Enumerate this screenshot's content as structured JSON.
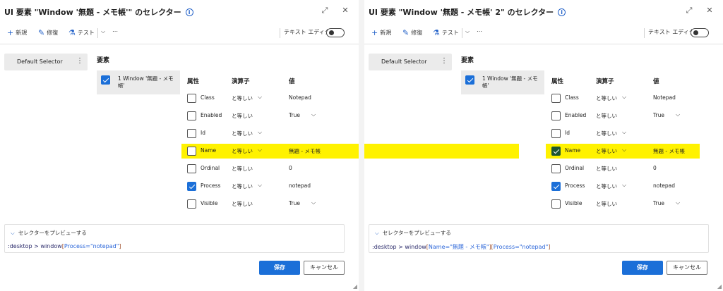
{
  "left": {
    "title": "UI 要素 \"Window '無題 - メモ帳'\" のセレクター",
    "toolbar": {
      "new_label": "新規",
      "edit_label": "修復",
      "test_label": "テスト",
      "text_editor_label": "テキスト エディター"
    },
    "selector_label": "Default Selector",
    "section_title": "要素",
    "element_label": "1 Window '無題 - メモ帳'",
    "headers": {
      "attribute": "属性",
      "operator": "演算子",
      "value": "値"
    },
    "rows": [
      {
        "name": "Class",
        "op": "と等しい",
        "value": "Notepad",
        "checked": false,
        "op_chevron": true,
        "val_chevron": false
      },
      {
        "name": "Enabled",
        "op": "と等しい",
        "value": "True",
        "checked": false,
        "op_chevron": false,
        "val_chevron": true
      },
      {
        "name": "Id",
        "op": "と等しい",
        "value": "",
        "checked": false,
        "op_chevron": true,
        "val_chevron": false
      },
      {
        "name": "Name",
        "op": "と等しい",
        "value": "無題 - メモ帳",
        "checked": false,
        "op_chevron": true,
        "val_chevron": false
      },
      {
        "name": "Ordinal",
        "op": "と等しい",
        "value": "0",
        "checked": false,
        "op_chevron": false,
        "val_chevron": false
      },
      {
        "name": "Process",
        "op": "と等しい",
        "value": "notepad",
        "checked": true,
        "op_chevron": true,
        "val_chevron": false
      },
      {
        "name": "Visible",
        "op": "と等しい",
        "value": "True",
        "checked": false,
        "op_chevron": false,
        "val_chevron": true
      }
    ],
    "preview_label": "セレクターをプレビューする",
    "expr": {
      "root": ":desktop",
      "gt": " > ",
      "tag": "window",
      "attrs": "Process=\"notepad\""
    },
    "save_label": "保存",
    "cancel_label": "キャンセル"
  },
  "right": {
    "title": "UI 要素 \"Window '無題 - メモ帳' 2\" のセレクター",
    "toolbar": {
      "new_label": "新規",
      "edit_label": "修復",
      "test_label": "テスト",
      "text_editor_label": "テキスト エディター"
    },
    "selector_label": "Default Selector",
    "section_title": "要素",
    "element_label": "1 Window '無題 - メモ帳'",
    "headers": {
      "attribute": "属性",
      "operator": "演算子",
      "value": "値"
    },
    "rows": [
      {
        "name": "Class",
        "op": "と等しい",
        "value": "Notepad",
        "checked": false,
        "op_chevron": true,
        "val_chevron": false
      },
      {
        "name": "Enabled",
        "op": "と等しい",
        "value": "True",
        "checked": false,
        "op_chevron": false,
        "val_chevron": true
      },
      {
        "name": "Id",
        "op": "と等しい",
        "value": "",
        "checked": false,
        "op_chevron": true,
        "val_chevron": false
      },
      {
        "name": "Name",
        "op": "と等しい",
        "value": "無題 - メモ帳",
        "checked": true,
        "op_chevron": true,
        "val_chevron": false
      },
      {
        "name": "Ordinal",
        "op": "と等しい",
        "value": "0",
        "checked": false,
        "op_chevron": false,
        "val_chevron": false
      },
      {
        "name": "Process",
        "op": "と等しい",
        "value": "notepad",
        "checked": true,
        "op_chevron": true,
        "val_chevron": false
      },
      {
        "name": "Visible",
        "op": "と等しい",
        "value": "True",
        "checked": false,
        "op_chevron": false,
        "val_chevron": true
      }
    ],
    "preview_label": "セレクターをプレビューする",
    "expr": {
      "root": ":desktop",
      "gt": " > ",
      "tag": "window",
      "attrs1": "Name=\"無題 - メモ帳\"",
      "attrs2": "Process=\"notepad\""
    },
    "save_label": "保存",
    "cancel_label": "キャンセル"
  },
  "colors": {
    "accent": "#1b6fd8",
    "highlight": "#fff200",
    "name_check": "#1e5631"
  }
}
